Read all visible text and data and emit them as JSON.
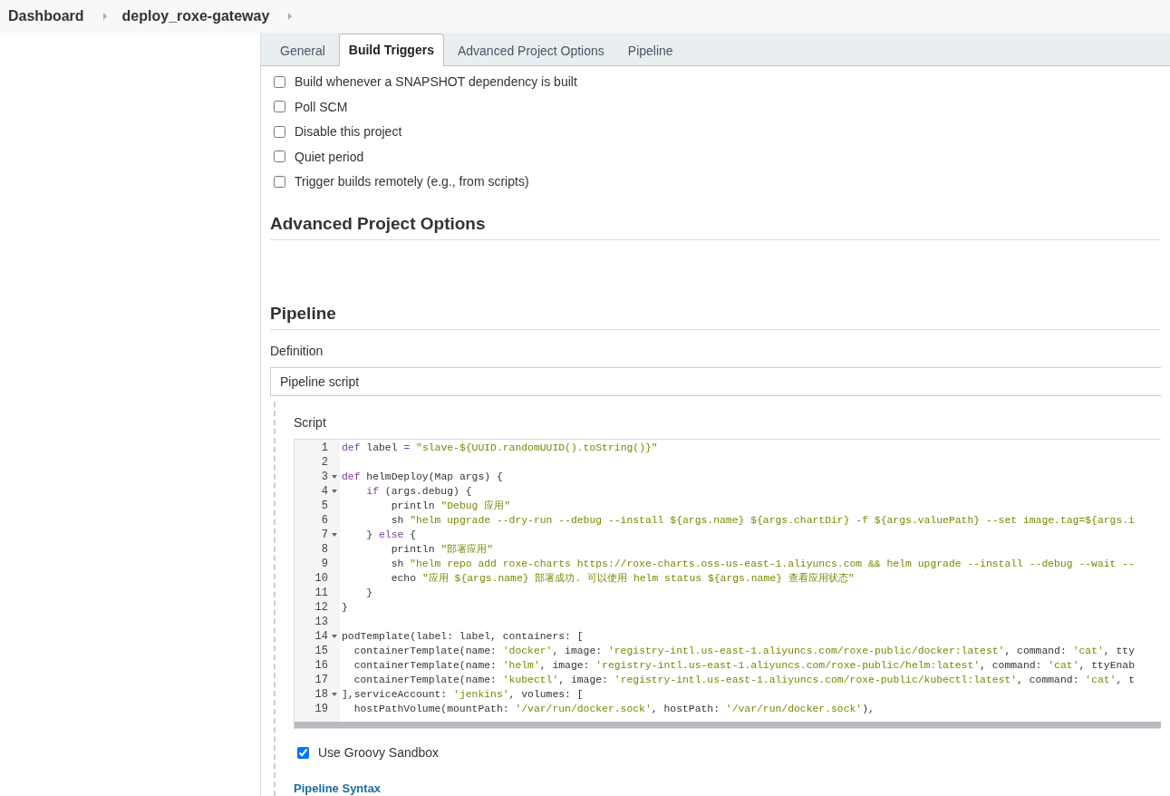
{
  "breadcrumb": [
    {
      "label": "Dashboard"
    },
    {
      "label": "deploy_roxe-gateway"
    }
  ],
  "tabs": [
    {
      "label": "General",
      "selected": false
    },
    {
      "label": "Build Triggers",
      "selected": true
    },
    {
      "label": "Advanced Project Options",
      "selected": false
    },
    {
      "label": "Pipeline",
      "selected": false
    }
  ],
  "triggers": [
    {
      "label": "Build whenever a SNAPSHOT dependency is built",
      "checked": false
    },
    {
      "label": "Poll SCM",
      "checked": false
    },
    {
      "label": "Disable this project",
      "checked": false
    },
    {
      "label": "Quiet period",
      "checked": false
    },
    {
      "label": "Trigger builds remotely (e.g., from scripts)",
      "checked": false
    }
  ],
  "advanced": {
    "title": "Advanced Project Options"
  },
  "pipeline": {
    "title": "Pipeline",
    "definition_label": "Definition",
    "definition_value": "Pipeline script",
    "script_label": "Script",
    "lines": [
      {
        "number": "1",
        "fold": false,
        "tokens": [
          {
            "kind": "keyword",
            "text": "def"
          },
          {
            "kind": "plain",
            "text": " label "
          },
          {
            "kind": "keyword",
            "text": "="
          },
          {
            "kind": "string",
            "text": " \"slave-${UUID.randomUUID().toString()}\""
          }
        ]
      },
      {
        "number": "2",
        "fold": false
      },
      {
        "number": "3",
        "fold": true,
        "tokens": [
          {
            "kind": "keyword",
            "text": "def"
          },
          {
            "kind": "plain",
            "text": " helmDeploy(Map args) {"
          }
        ]
      },
      {
        "number": "4",
        "fold": true,
        "tokens": [
          {
            "kind": "keyword",
            "text": "    if"
          },
          {
            "kind": "plain",
            "text": " (args.debug) {"
          }
        ]
      },
      {
        "number": "5",
        "fold": false,
        "tokens": [
          {
            "kind": "plain",
            "text": "        println "
          },
          {
            "kind": "string",
            "text": "\"Debug 应用\""
          }
        ]
      },
      {
        "number": "6",
        "fold": false,
        "tokens": [
          {
            "kind": "plain",
            "text": "        sh "
          },
          {
            "kind": "string",
            "text": "\"helm upgrade --dry-run --debug --install ${args.name} ${args.chartDir} -f ${args.valuePath} --set image.tag=${args.i"
          }
        ]
      },
      {
        "number": "7",
        "fold": true,
        "tokens": [
          {
            "kind": "plain",
            "text": "    } "
          },
          {
            "kind": "keyword",
            "text": "else"
          },
          {
            "kind": "plain",
            "text": " {"
          }
        ]
      },
      {
        "number": "8",
        "fold": false,
        "tokens": [
          {
            "kind": "plain",
            "text": "        println "
          },
          {
            "kind": "string",
            "text": "\"部署应用\""
          }
        ]
      },
      {
        "number": "9",
        "fold": false,
        "tokens": [
          {
            "kind": "plain",
            "text": "        sh "
          },
          {
            "kind": "string",
            "text": "\"helm repo add roxe-charts https://roxe-charts.oss-us-east-1.aliyuncs.com && helm upgrade --install --debug --wait --"
          }
        ]
      },
      {
        "number": "10",
        "fold": false,
        "tokens": [
          {
            "kind": "plain",
            "text": "        echo "
          },
          {
            "kind": "string",
            "text": "\"应用 ${args.name} 部署成功. 可以使用 helm status ${args.name} 查看应用状态\""
          }
        ]
      },
      {
        "number": "11",
        "fold": false,
        "tokens": [
          {
            "kind": "plain",
            "text": "    }"
          }
        ]
      },
      {
        "number": "12",
        "fold": false,
        "tokens": [
          {
            "kind": "plain",
            "text": "}"
          }
        ]
      },
      {
        "number": "13",
        "fold": false
      },
      {
        "number": "14",
        "fold": true,
        "tokens": [
          {
            "kind": "plain",
            "text": "podTemplate(label: label, containers: ["
          }
        ]
      },
      {
        "number": "15",
        "fold": false,
        "tokens": [
          {
            "kind": "plain",
            "text": "  containerTemplate(name: "
          },
          {
            "kind": "string",
            "text": "'docker'"
          },
          {
            "kind": "plain",
            "text": ", image: "
          },
          {
            "kind": "string",
            "text": "'registry-intl.us-east-1.aliyuncs.com/roxe-public/docker:latest'"
          },
          {
            "kind": "plain",
            "text": ", command: "
          },
          {
            "kind": "string",
            "text": "'cat'"
          },
          {
            "kind": "plain",
            "text": ", tty"
          }
        ]
      },
      {
        "number": "16",
        "fold": false,
        "tokens": [
          {
            "kind": "plain",
            "text": "  containerTemplate(name: "
          },
          {
            "kind": "string",
            "text": "'helm'"
          },
          {
            "kind": "plain",
            "text": ", image: "
          },
          {
            "kind": "string",
            "text": "'registry-intl.us-east-1.aliyuncs.com/roxe-public/helm:latest'"
          },
          {
            "kind": "plain",
            "text": ", command: "
          },
          {
            "kind": "string",
            "text": "'cat'"
          },
          {
            "kind": "plain",
            "text": ", ttyEnab"
          }
        ]
      },
      {
        "number": "17",
        "fold": false,
        "tokens": [
          {
            "kind": "plain",
            "text": "  containerTemplate(name: "
          },
          {
            "kind": "string",
            "text": "'kubectl'"
          },
          {
            "kind": "plain",
            "text": ", image: "
          },
          {
            "kind": "string",
            "text": "'registry-intl.us-east-1.aliyuncs.com/roxe-public/kubectl:latest'"
          },
          {
            "kind": "plain",
            "text": ", command: "
          },
          {
            "kind": "string",
            "text": "'cat'"
          },
          {
            "kind": "plain",
            "text": ", t"
          }
        ]
      },
      {
        "number": "18",
        "fold": true,
        "tokens": [
          {
            "kind": "plain",
            "text": "],serviceAccount: "
          },
          {
            "kind": "string",
            "text": "'jenkins'"
          },
          {
            "kind": "plain",
            "text": ", volumes: ["
          }
        ]
      },
      {
        "number": "19",
        "fold": false,
        "tokens": [
          {
            "kind": "plain",
            "text": "  hostPathVolume(mountPath: "
          },
          {
            "kind": "string",
            "text": "'/var/run/docker.sock'"
          },
          {
            "kind": "plain",
            "text": ", hostPath: "
          },
          {
            "kind": "string",
            "text": "'/var/run/docker.sock'"
          },
          {
            "kind": "plain",
            "text": "),"
          }
        ]
      }
    ],
    "sandbox": {
      "label": "Use Groovy Sandbox",
      "checked": true
    },
    "syntax_link": "Pipeline Syntax"
  }
}
